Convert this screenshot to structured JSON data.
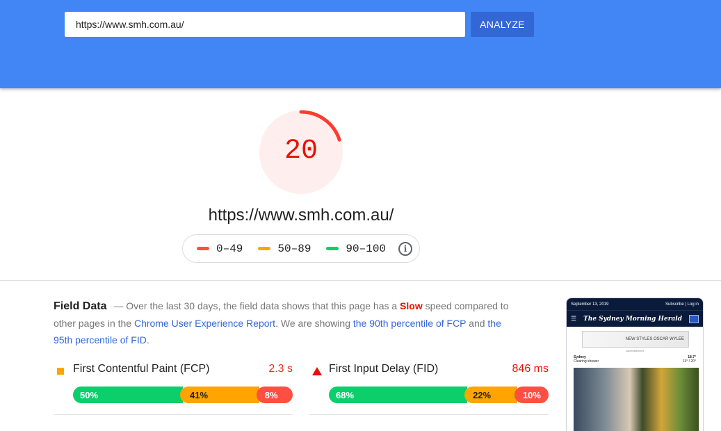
{
  "search": {
    "url_value": "https://www.smh.com.au/",
    "analyze_label": "ANALYZE"
  },
  "summary": {
    "score": "20",
    "score_fraction": 0.2,
    "url": "https://www.smh.com.au/"
  },
  "legend": {
    "items": [
      {
        "label": "0–49",
        "color": "#ff4e42"
      },
      {
        "label": "50–89",
        "color": "#ffa400"
      },
      {
        "label": "90–100",
        "color": "#0cce6b"
      }
    ]
  },
  "field_data": {
    "title": "Field Data",
    "dash": "—",
    "sentence_start": "Over the last 30 days, the field data shows that this page has a",
    "speed": "Slow",
    "sentence_mid": "speed compared to other pages in the",
    "crux_link": "Chrome User Experience Report",
    "showing": ". We are showing",
    "fcp_link": "the 90th percentile of FCP",
    "and": "and",
    "fid_link": "the 95th percentile of FID",
    "period": "."
  },
  "metrics": {
    "fcp": {
      "name": "First Contentful Paint (FCP)",
      "value": "2.3 s",
      "fast": "50%",
      "average": "41%",
      "slow": "8%"
    },
    "fid": {
      "name": "First Input Delay (FID)",
      "value": "846 ms",
      "fast": "68%",
      "average": "22%",
      "slow": "10%"
    }
  },
  "colors": {
    "fast": "#0cce6b",
    "average": "#ffa400",
    "slow": "#ff4e42",
    "accent": "#4285f4"
  },
  "thumbnail": {
    "date": "September 13, 2019",
    "subscribe": "Subscribe",
    "login": "Log in",
    "masthead": "The Sydney Morning Herald",
    "ad_text": "NEW STYLES  OSCAR WYLEE",
    "ad_label": "Advertisement",
    "city": "Sydney",
    "forecast": "Clearing shower",
    "temp": "18.7°",
    "range": "13° / 20°"
  }
}
